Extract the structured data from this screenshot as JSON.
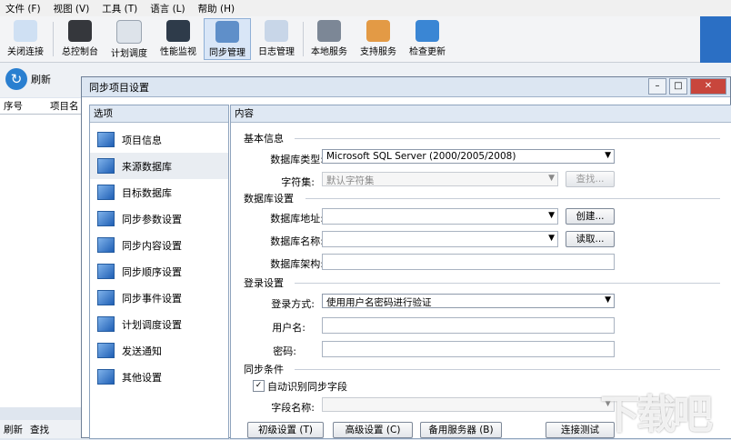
{
  "menu": [
    "文件 (F)",
    "视图 (V)",
    "工具 (T)",
    "语言 (L)",
    "帮助 (H)"
  ],
  "toolbar": [
    {
      "label": "关闭连接",
      "icon": "disconnect-icon"
    },
    {
      "label": "总控制台",
      "icon": "console-icon"
    },
    {
      "label": "计划调度",
      "icon": "schedule-icon"
    },
    {
      "label": "性能监视",
      "icon": "monitor-icon"
    },
    {
      "label": "同步管理",
      "icon": "sync-manage-icon"
    },
    {
      "label": "日志管理",
      "icon": "log-icon"
    },
    {
      "label": "本地服务",
      "icon": "local-service-icon"
    },
    {
      "label": "支持服务",
      "icon": "support-icon"
    },
    {
      "label": "检查更新",
      "icon": "update-icon"
    }
  ],
  "secondary": {
    "refresh": "刷新"
  },
  "list": {
    "col_index": "序号",
    "col_name": "项目名"
  },
  "bottom": {
    "refresh": "刷新",
    "search": "查找"
  },
  "dialog": {
    "title": "同步项目设置",
    "options_header": "选项",
    "content_header": "内容",
    "options": [
      "项目信息",
      "来源数据库",
      "目标数据库",
      "同步参数设置",
      "同步内容设置",
      "同步顺序设置",
      "同步事件设置",
      "计划调度设置",
      "发送通知",
      "其他设置"
    ],
    "selected_option": 1,
    "sections": {
      "basic": "基本信息",
      "db": "数据库设置",
      "login": "登录设置",
      "sync": "同步条件"
    },
    "labels": {
      "db_type": "数据库类型:",
      "charset": "字符集:",
      "db_address": "数据库地址:",
      "db_name": "数据库名称:",
      "db_schema": "数据库架构:",
      "login_mode": "登录方式:",
      "username": "用户名:",
      "password": "密码:",
      "auto_detect": "自动识别同步字段",
      "field_name": "字段名称:"
    },
    "values": {
      "db_type": "Microsoft SQL Server (2000/2005/2008)",
      "charset": "默认字符集",
      "login_mode": "使用用户名密码进行验证"
    },
    "buttons": {
      "find": "查找...",
      "create": "创建...",
      "read": "读取..."
    },
    "bottom_buttons": [
      "初级设置 (T)",
      "高级设置 (C)",
      "备用服务器 (B)",
      "连接测试"
    ]
  },
  "watermark": "下载吧"
}
